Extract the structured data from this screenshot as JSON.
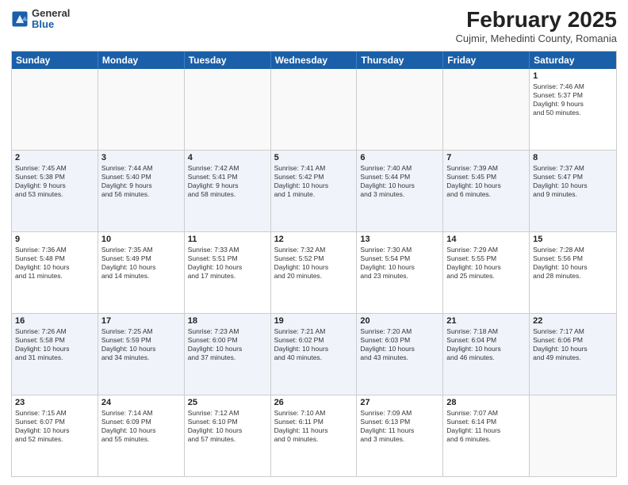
{
  "logo": {
    "general": "General",
    "blue": "Blue"
  },
  "title": "February 2025",
  "subtitle": "Cujmir, Mehedinti County, Romania",
  "days": [
    "Sunday",
    "Monday",
    "Tuesday",
    "Wednesday",
    "Thursday",
    "Friday",
    "Saturday"
  ],
  "weeks": [
    [
      {
        "day": "",
        "text": ""
      },
      {
        "day": "",
        "text": ""
      },
      {
        "day": "",
        "text": ""
      },
      {
        "day": "",
        "text": ""
      },
      {
        "day": "",
        "text": ""
      },
      {
        "day": "",
        "text": ""
      },
      {
        "day": "1",
        "text": "Sunrise: 7:46 AM\nSunset: 5:37 PM\nDaylight: 9 hours\nand 50 minutes."
      }
    ],
    [
      {
        "day": "2",
        "text": "Sunrise: 7:45 AM\nSunset: 5:38 PM\nDaylight: 9 hours\nand 53 minutes."
      },
      {
        "day": "3",
        "text": "Sunrise: 7:44 AM\nSunset: 5:40 PM\nDaylight: 9 hours\nand 56 minutes."
      },
      {
        "day": "4",
        "text": "Sunrise: 7:42 AM\nSunset: 5:41 PM\nDaylight: 9 hours\nand 58 minutes."
      },
      {
        "day": "5",
        "text": "Sunrise: 7:41 AM\nSunset: 5:42 PM\nDaylight: 10 hours\nand 1 minute."
      },
      {
        "day": "6",
        "text": "Sunrise: 7:40 AM\nSunset: 5:44 PM\nDaylight: 10 hours\nand 3 minutes."
      },
      {
        "day": "7",
        "text": "Sunrise: 7:39 AM\nSunset: 5:45 PM\nDaylight: 10 hours\nand 6 minutes."
      },
      {
        "day": "8",
        "text": "Sunrise: 7:37 AM\nSunset: 5:47 PM\nDaylight: 10 hours\nand 9 minutes."
      }
    ],
    [
      {
        "day": "9",
        "text": "Sunrise: 7:36 AM\nSunset: 5:48 PM\nDaylight: 10 hours\nand 11 minutes."
      },
      {
        "day": "10",
        "text": "Sunrise: 7:35 AM\nSunset: 5:49 PM\nDaylight: 10 hours\nand 14 minutes."
      },
      {
        "day": "11",
        "text": "Sunrise: 7:33 AM\nSunset: 5:51 PM\nDaylight: 10 hours\nand 17 minutes."
      },
      {
        "day": "12",
        "text": "Sunrise: 7:32 AM\nSunset: 5:52 PM\nDaylight: 10 hours\nand 20 minutes."
      },
      {
        "day": "13",
        "text": "Sunrise: 7:30 AM\nSunset: 5:54 PM\nDaylight: 10 hours\nand 23 minutes."
      },
      {
        "day": "14",
        "text": "Sunrise: 7:29 AM\nSunset: 5:55 PM\nDaylight: 10 hours\nand 25 minutes."
      },
      {
        "day": "15",
        "text": "Sunrise: 7:28 AM\nSunset: 5:56 PM\nDaylight: 10 hours\nand 28 minutes."
      }
    ],
    [
      {
        "day": "16",
        "text": "Sunrise: 7:26 AM\nSunset: 5:58 PM\nDaylight: 10 hours\nand 31 minutes."
      },
      {
        "day": "17",
        "text": "Sunrise: 7:25 AM\nSunset: 5:59 PM\nDaylight: 10 hours\nand 34 minutes."
      },
      {
        "day": "18",
        "text": "Sunrise: 7:23 AM\nSunset: 6:00 PM\nDaylight: 10 hours\nand 37 minutes."
      },
      {
        "day": "19",
        "text": "Sunrise: 7:21 AM\nSunset: 6:02 PM\nDaylight: 10 hours\nand 40 minutes."
      },
      {
        "day": "20",
        "text": "Sunrise: 7:20 AM\nSunset: 6:03 PM\nDaylight: 10 hours\nand 43 minutes."
      },
      {
        "day": "21",
        "text": "Sunrise: 7:18 AM\nSunset: 6:04 PM\nDaylight: 10 hours\nand 46 minutes."
      },
      {
        "day": "22",
        "text": "Sunrise: 7:17 AM\nSunset: 6:06 PM\nDaylight: 10 hours\nand 49 minutes."
      }
    ],
    [
      {
        "day": "23",
        "text": "Sunrise: 7:15 AM\nSunset: 6:07 PM\nDaylight: 10 hours\nand 52 minutes."
      },
      {
        "day": "24",
        "text": "Sunrise: 7:14 AM\nSunset: 6:09 PM\nDaylight: 10 hours\nand 55 minutes."
      },
      {
        "day": "25",
        "text": "Sunrise: 7:12 AM\nSunset: 6:10 PM\nDaylight: 10 hours\nand 57 minutes."
      },
      {
        "day": "26",
        "text": "Sunrise: 7:10 AM\nSunset: 6:11 PM\nDaylight: 11 hours\nand 0 minutes."
      },
      {
        "day": "27",
        "text": "Sunrise: 7:09 AM\nSunset: 6:13 PM\nDaylight: 11 hours\nand 3 minutes."
      },
      {
        "day": "28",
        "text": "Sunrise: 7:07 AM\nSunset: 6:14 PM\nDaylight: 11 hours\nand 6 minutes."
      },
      {
        "day": "",
        "text": ""
      }
    ]
  ]
}
